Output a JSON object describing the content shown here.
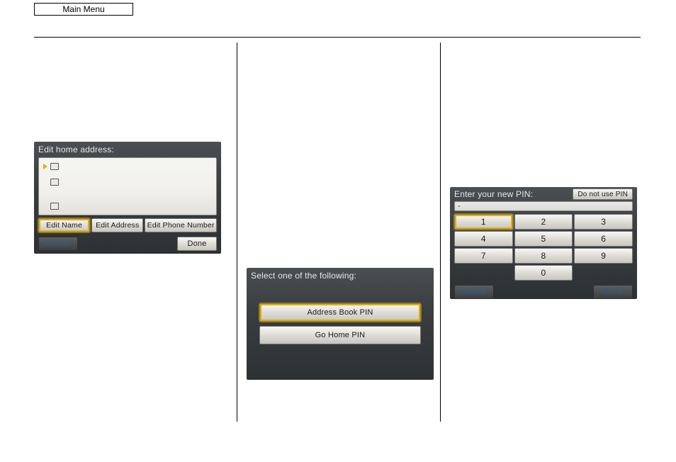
{
  "top_button": "Main Menu",
  "screen1": {
    "title": "Edit home address:",
    "edit_name": "Edit Name",
    "edit_address": "Edit Address",
    "edit_phone": "Edit Phone Number",
    "delete": "Delete",
    "done": "Done"
  },
  "screen2": {
    "title": "Select one of the following:",
    "opt1": "Address Book PIN",
    "opt2": "Go Home PIN"
  },
  "screen3": {
    "title": "Enter your new PIN:",
    "do_not_use": "Do not use PIN",
    "field_value": "-",
    "keys": [
      "1",
      "2",
      "3",
      "4",
      "5",
      "6",
      "7",
      "8",
      "9",
      "0"
    ],
    "delete": "Delete",
    "done": "Done"
  }
}
